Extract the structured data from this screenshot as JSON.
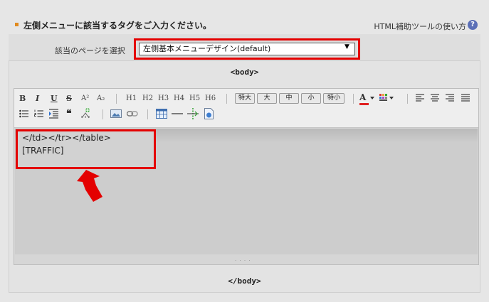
{
  "header": {
    "title": "左側メニューに該当するタグをご入力ください。",
    "help_link": "HTML補助ツールの使い方",
    "help_icon": "?"
  },
  "page_select": {
    "label": "該当のページを選択",
    "value": "左側基本メニューデザイン(default)",
    "arrow": "▼"
  },
  "editor": {
    "body_open": "<body>",
    "body_close": "</body>",
    "toolbar": {
      "bold": "B",
      "italic": "I",
      "underline": "U",
      "strike": "S",
      "superscript": "A²",
      "subscript": "A₂",
      "headings": [
        "H1",
        "H2",
        "H3",
        "H4",
        "H5",
        "H6"
      ],
      "sizes": [
        "特大",
        "大",
        "中",
        "小",
        "特小"
      ],
      "font_color": "A",
      "quote": "❝"
    },
    "content_lines": [
      "</td></tr></table>",
      "[TRAFFIC]"
    ]
  },
  "colors": {
    "highlight": "#e40000",
    "accent_bullet": "#e08a1e",
    "help_icon": "#5b6fb7"
  }
}
